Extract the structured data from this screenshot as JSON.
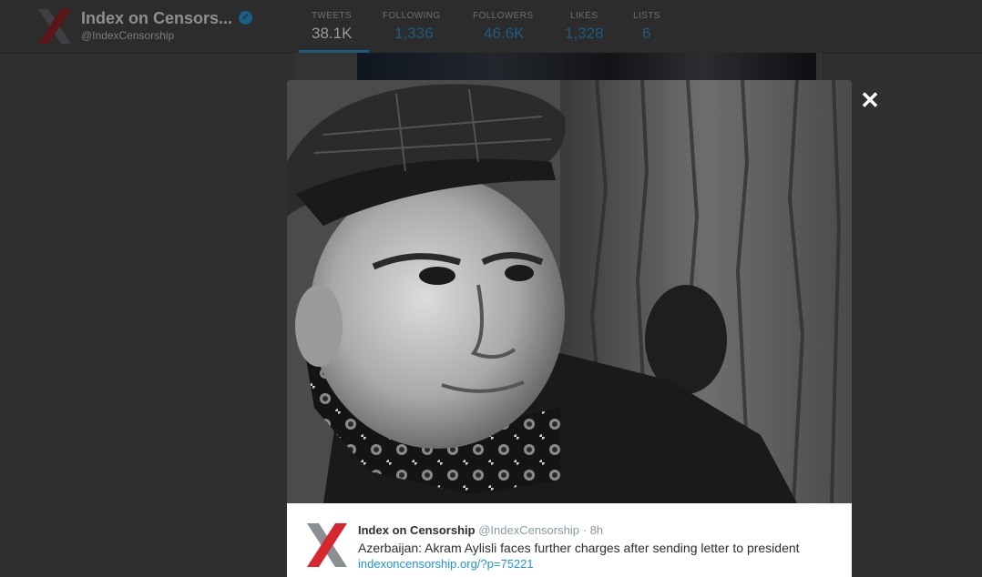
{
  "profile": {
    "name": "Index on Censors...",
    "handle": "@IndexCensorship",
    "stats": [
      {
        "label": "TWEETS",
        "value": "38.1K"
      },
      {
        "label": "FOLLOWING",
        "value": "1,336"
      },
      {
        "label": "FOLLOWERS",
        "value": "46.6K"
      },
      {
        "label": "LIKES",
        "value": "1,328"
      },
      {
        "label": "LISTS",
        "value": "6"
      }
    ],
    "active_tab": "TWEETS"
  },
  "lightbox": {
    "close_icon": "✕",
    "tweet": {
      "author_name": "Index on Censorship",
      "author_handle": "@IndexCensorship",
      "separator": "·",
      "time": "8h",
      "text": "Azerbaijan: Akram Aylisli faces further charges after sending letter to president",
      "link": "indexoncensorship.org/?p=75221"
    }
  },
  "colors": {
    "brand_red": "#d6262f",
    "brand_grey": "#8a8f93",
    "link_blue": "#1b95e0",
    "overlay": "#2f2f2f"
  },
  "icons": [
    "index-x-logo-icon",
    "verified-badge-icon",
    "close-icon"
  ]
}
